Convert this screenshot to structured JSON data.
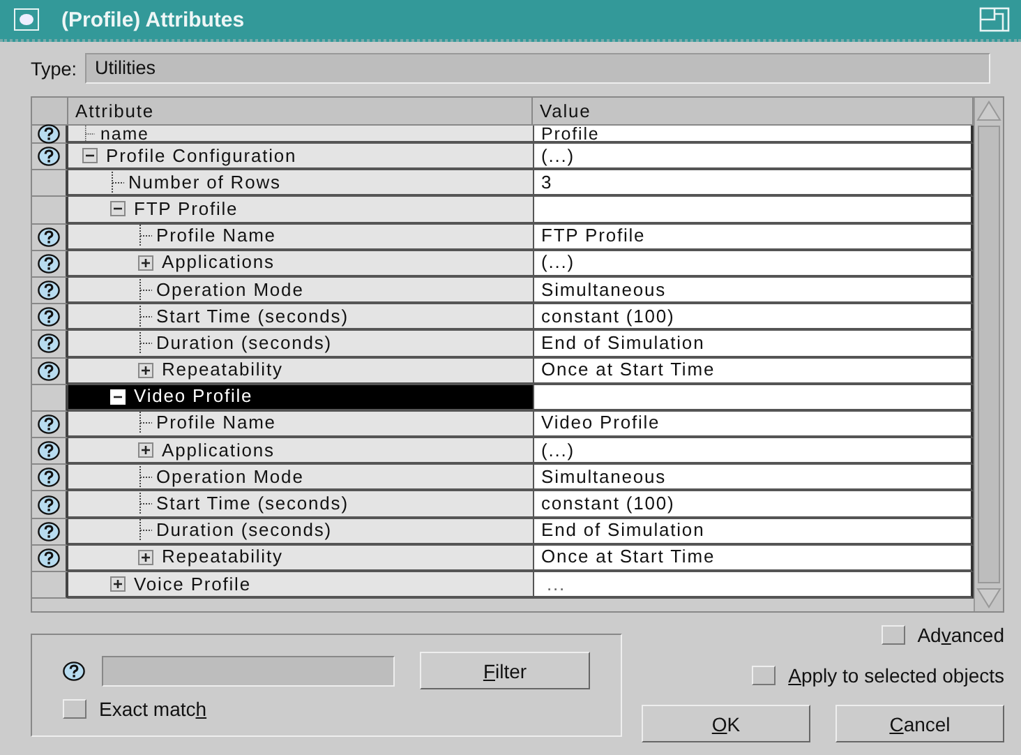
{
  "window": {
    "title": "(Profile) Attributes"
  },
  "type_field": {
    "label": "Type:",
    "value": "Utilities"
  },
  "table": {
    "columns": [
      "Attribute",
      "Value"
    ],
    "rows": [
      {
        "attribute": "name",
        "value": "Profile",
        "help": true,
        "selected": false,
        "partial": true
      },
      {
        "attribute": "Profile Configuration",
        "value": "(...)",
        "help": true,
        "expanded": true,
        "selected": false,
        "children": [
          {
            "attribute": "Number of Rows",
            "value": "3",
            "help": false,
            "selected": false
          },
          {
            "attribute": "FTP Profile",
            "help": false,
            "expanded": true,
            "selected": false,
            "children": [
              {
                "attribute": "Profile Name",
                "value": "FTP Profile",
                "help": true,
                "selected": false
              },
              {
                "attribute": "Applications",
                "value": "(...)",
                "help": true,
                "expanded": false,
                "selected": false
              },
              {
                "attribute": "Operation Mode",
                "value": "Simultaneous",
                "help": true,
                "selected": false
              },
              {
                "attribute": "Start Time (seconds)",
                "value": "constant (100)",
                "help": true,
                "selected": false
              },
              {
                "attribute": "Duration (seconds)",
                "value": "End of Simulation",
                "help": true,
                "selected": false
              },
              {
                "attribute": "Repeatability",
                "value": "Once at Start Time",
                "help": true,
                "expanded": false,
                "selected": false
              }
            ]
          },
          {
            "attribute": "Video Profile",
            "help": false,
            "expanded": true,
            "selected": true,
            "children": [
              {
                "attribute": "Profile Name",
                "value": "Video Profile",
                "help": true,
                "selected": false
              },
              {
                "attribute": "Applications",
                "value": "(...)",
                "help": true,
                "expanded": false,
                "selected": false
              },
              {
                "attribute": "Operation Mode",
                "value": "Simultaneous",
                "help": true,
                "selected": false
              },
              {
                "attribute": "Start Time (seconds)",
                "value": "constant (100)",
                "help": true,
                "selected": false
              },
              {
                "attribute": "Duration (seconds)",
                "value": "End of Simulation",
                "help": true,
                "selected": false
              },
              {
                "attribute": "Repeatability",
                "value": "Once at Start Time",
                "help": true,
                "expanded": false,
                "selected": false
              }
            ]
          },
          {
            "attribute": "Voice Profile",
            "value": "...",
            "help": false,
            "expanded": false,
            "selected": false
          }
        ]
      }
    ]
  },
  "filter": {
    "button": [
      {
        "text": "F",
        "underline": true
      },
      {
        "text": "ilter",
        "underline": false
      }
    ],
    "exact_match": {
      "label": [
        {
          "text": "Exact matc",
          "underline": false
        },
        {
          "text": "h",
          "underline": true
        }
      ],
      "checked": false
    }
  },
  "advanced": {
    "label": [
      {
        "text": "Ad",
        "underline": false
      },
      {
        "text": "v",
        "underline": true
      },
      {
        "text": "anced",
        "underline": false
      }
    ],
    "checked": false
  },
  "apply_to_selected": {
    "label": [
      {
        "text": "A",
        "underline": true
      },
      {
        "text": "pply to selected objects",
        "underline": false
      }
    ],
    "checked": false
  },
  "buttons": [
    [
      {
        "text": "O",
        "underline": true
      },
      {
        "text": "K",
        "underline": false
      }
    ],
    [
      {
        "text": "C",
        "underline": true
      },
      {
        "text": "ancel",
        "underline": false
      }
    ]
  ]
}
